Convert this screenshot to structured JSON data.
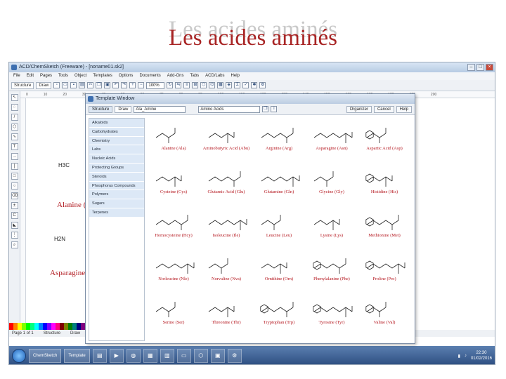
{
  "slide": {
    "title": "Les acides aminés"
  },
  "app": {
    "window_title": "ACD/ChemSketch (Freeware) - [noname01.sk2]",
    "menu": [
      "File",
      "Edit",
      "Pages",
      "Tools",
      "Object",
      "Templates",
      "Options",
      "Documents",
      "Add-Ons",
      "Tabs",
      "ACD/Labs",
      "Help"
    ],
    "toolbar": {
      "structure_tab": "Structure",
      "draw_tab": "Draw",
      "zoom": "100%"
    },
    "ruler_ticks": [
      "0",
      "10",
      "20",
      "30",
      "40",
      "50",
      "60",
      "70",
      "80",
      "90",
      "100",
      "110",
      "120",
      "130",
      "140",
      "150",
      "160",
      "170",
      "180",
      "190",
      "200"
    ],
    "background": {
      "labels": [
        "Alanine (Ala)",
        "Asparagine"
      ],
      "atoms": [
        "H3C",
        "NH",
        "H2N"
      ]
    },
    "status": [
      "Page 1 of 1",
      "Structure",
      "Draw"
    ],
    "accent_color": "#3d6fb0"
  },
  "template_window": {
    "title": "Template Window",
    "structure_tab": "Structure",
    "draw_tab": "Draw",
    "category_value": "Amino Acids",
    "subset_value": "Ala_Amine",
    "organizer_button": "Organizer",
    "cancel_button": "Cancel",
    "help_button": "Help",
    "categories": [
      "Alkaloids",
      "Carbohydrates",
      "Chemistry",
      "Labs",
      "Nucleic Acids",
      "Protecting Groups",
      "Steroids",
      "Phosphorus Compounds",
      "Polymers",
      "Sugars",
      "Terpenes",
      "Amino Acids"
    ],
    "selected_category": "Amino Acids"
  },
  "amino_acids": [
    {
      "name": "Alanine (Ala)"
    },
    {
      "name": "Aminobutyric Acid (Abu)"
    },
    {
      "name": "Arginine (Arg)"
    },
    {
      "name": "Asparagine (Asn)"
    },
    {
      "name": "Aspartic Acid (Asp)"
    },
    {
      "name": "Cysteine (Cys)"
    },
    {
      "name": "Glutamic Acid (Glu)"
    },
    {
      "name": "Glutamine (Gln)"
    },
    {
      "name": "Glycine (Gly)"
    },
    {
      "name": "Histidine (His)"
    },
    {
      "name": "Homocysteine (Hcy)"
    },
    {
      "name": "Isoleucine (Ile)"
    },
    {
      "name": "Leucine (Leu)"
    },
    {
      "name": "Lysine (Lys)"
    },
    {
      "name": "Methionine (Met)"
    },
    {
      "name": "Norleucine (Nle)"
    },
    {
      "name": "Norvaline (Nva)"
    },
    {
      "name": "Ornithine (Orn)"
    },
    {
      "name": "Phenylalanine (Phe)"
    },
    {
      "name": "Proline (Pro)"
    },
    {
      "name": "Serine (Ser)"
    },
    {
      "name": "Threonine (Thr)"
    },
    {
      "name": "Tryptophan (Trp)"
    },
    {
      "name": "Tyrosine (Tyr)"
    },
    {
      "name": "Valine (Val)"
    }
  ],
  "taskbar": {
    "items": [
      "ChemSketch",
      "Template"
    ],
    "clock_time": "22:30",
    "clock_date": "01/02/2016"
  }
}
